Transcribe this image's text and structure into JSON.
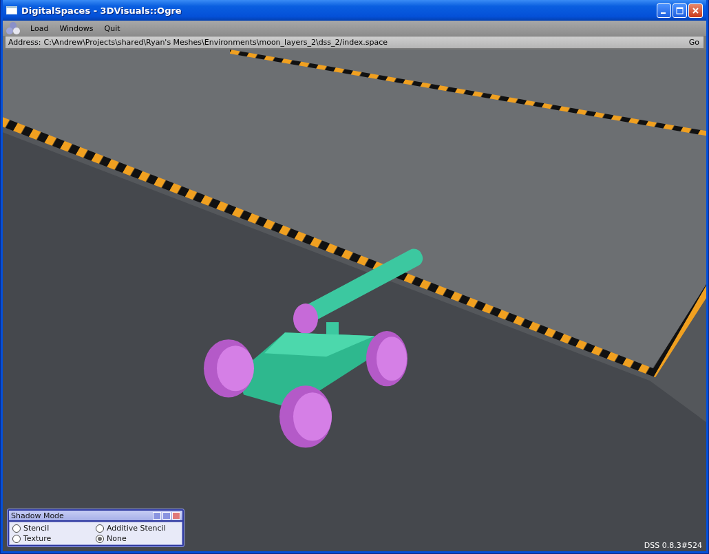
{
  "window": {
    "title": "DigitalSpaces - 3DVisuals::Ogre"
  },
  "menu": [
    "Load",
    "Windows",
    "Quit"
  ],
  "address_bar": {
    "label": "Address:",
    "value": "C:\\Andrew\\Projects\\shared\\Ryan's Meshes\\Environments\\moon_layers_2\\dss_2/index.space",
    "button": "Go"
  },
  "shadow_mode": {
    "title": "Shadow Mode",
    "options": [
      {
        "label": "Stencil",
        "selected": false
      },
      {
        "label": "Additive Stencil",
        "selected": false
      },
      {
        "label": "Texture",
        "selected": false
      },
      {
        "label": "None",
        "selected": true
      }
    ]
  },
  "version": "DSS 0.8.3#524"
}
